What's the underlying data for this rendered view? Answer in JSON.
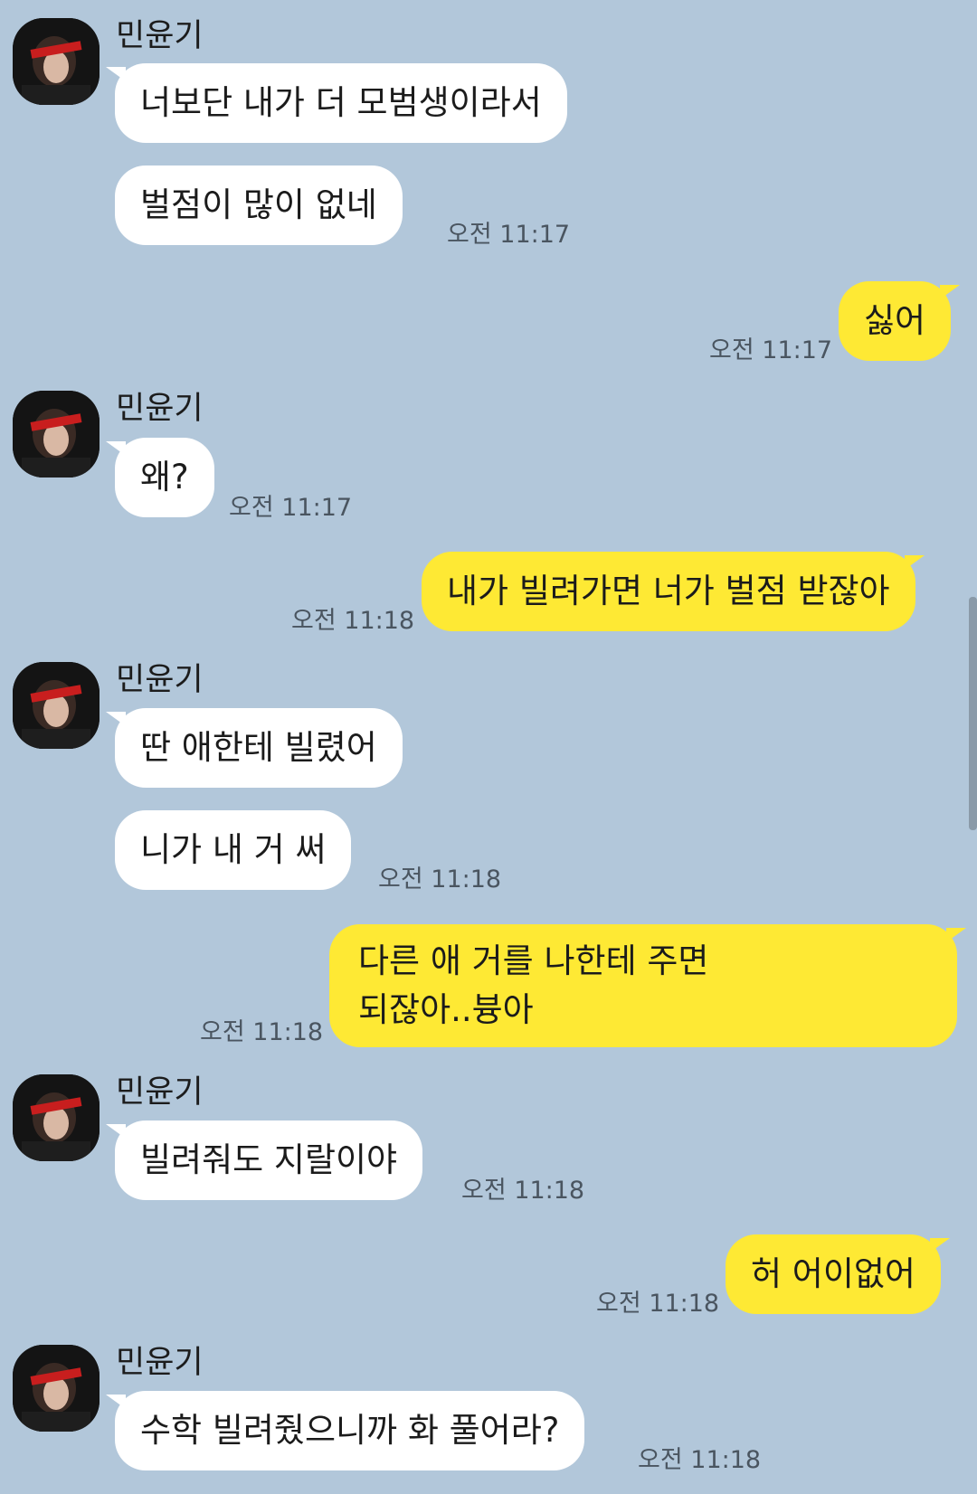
{
  "sender_name": "민윤기",
  "messages": [
    {
      "text": "너보단 내가 더 모범생이라서"
    },
    {
      "text": "벌점이 많이 없네",
      "time": "오전 11:17"
    },
    {
      "text": "싫어",
      "time": "오전 11:17"
    },
    {
      "text": "왜?",
      "time": "오전 11:17"
    },
    {
      "text": "내가 빌려가면 너가 벌점 받잖아",
      "time": "오전 11:18"
    },
    {
      "text": "딴 애한테 빌렸어"
    },
    {
      "text": "니가 내 거 써",
      "time": "오전 11:18"
    },
    {
      "line1": "다른 애 거를 나한테 주면",
      "line2": "되잖아..븅아",
      "time": "오전 11:18"
    },
    {
      "text": "빌려줘도 지랄이야",
      "time": "오전 11:18"
    },
    {
      "text": "허 어이없어",
      "time": "오전 11:18"
    },
    {
      "text": "수학 빌려줬으니까 화 풀어라?",
      "time": "오전 11:18"
    }
  ]
}
